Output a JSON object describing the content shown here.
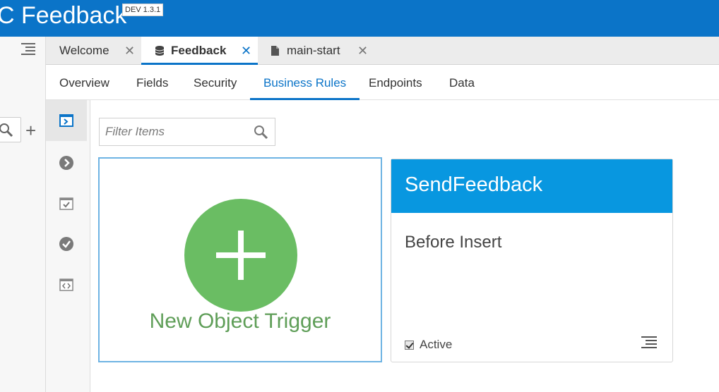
{
  "header": {
    "title": "C Feedback",
    "version": "DEV 1.3.1"
  },
  "tabs": [
    {
      "label": "Welcome",
      "icon": "none",
      "active": false
    },
    {
      "label": "Feedback",
      "icon": "database-icon",
      "active": true
    },
    {
      "label": "main-start",
      "icon": "file-icon",
      "active": false
    }
  ],
  "tab_close_glyph": "✕",
  "subnav": {
    "items": [
      "Overview",
      "Fields",
      "Security",
      "Business Rules",
      "Endpoints",
      "Data"
    ],
    "active": "Business Rules"
  },
  "filter": {
    "placeholder": "Filter Items"
  },
  "new_trigger": {
    "label": "New Object Trigger"
  },
  "rule_card": {
    "title": "SendFeedback",
    "event": "Before Insert",
    "active_label": "Active",
    "active": true
  },
  "left_rail": {
    "plus": "+"
  },
  "colors": {
    "brand": "#0b74c8",
    "card_header": "#0897e0",
    "new_trigger_green": "#6abd63"
  }
}
